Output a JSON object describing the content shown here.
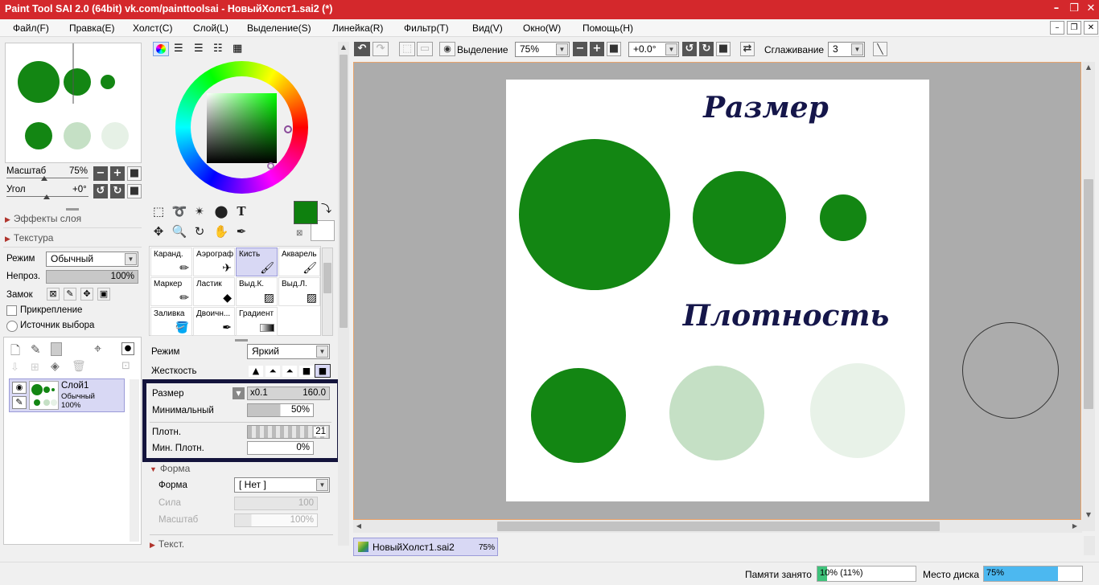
{
  "window": {
    "title": "Paint Tool SAI 2.0 (64bit) vk.com/painttoolsai - НовыйХолст1.sai2 (*)"
  },
  "menu": [
    "Файл(F)",
    "Правка(E)",
    "Холст(C)",
    "Слой(L)",
    "Выделение(S)",
    "Линейка(R)",
    "Фильтр(T)",
    "Вид(V)",
    "Окно(W)",
    "Помощь(H)"
  ],
  "nav": {
    "scale_label": "Масштаб",
    "scale_value": "75%",
    "angle_label": "Угол",
    "angle_value": "+0°"
  },
  "sections": {
    "layer_effects": "Эффекты слоя",
    "texture": "Текстура",
    "shape": "Форма",
    "text": "Текст."
  },
  "layer": {
    "mode_label": "Режим",
    "mode_value": "Обычный",
    "opacity_label": "Непроз.",
    "opacity_value": "100%",
    "lock_label": "Замок",
    "clip_label": "Прикрепление",
    "source_label": "Источник выбора",
    "name": "Слой1",
    "mode": "Обычный",
    "opacity": "100%"
  },
  "brushes": [
    [
      "Каранд.",
      "Аэрограф",
      "Кисть",
      "Акварель"
    ],
    [
      "Маркер",
      "Ластик",
      "Выд.К.",
      "Выд.Л."
    ],
    [
      "Заливка",
      "Двоичн...",
      "Градиент",
      ""
    ]
  ],
  "brush_settings": {
    "mode_label": "Режим",
    "mode_value": "Яркий",
    "hardness_label": "Жесткость",
    "size_label": "Размер",
    "size_mult": "x0.1",
    "size_value": "160.0",
    "min_label": "Минимальный",
    "min_value": "50%",
    "density_label": "Плотн.",
    "density_value": "21",
    "min_density_label": "Мин. Плотн.",
    "min_density_value": "0%",
    "shape_label": "Форма",
    "shape_value": "[ Нет ]",
    "strength_label": "Сила",
    "strength_value": "100",
    "scale_label": "Масштаб",
    "scale_value": "100%"
  },
  "toolbar": {
    "selection_label": "Выделение",
    "zoom_value": "75%",
    "angle_value": "+0.0°",
    "smoothing_label": "Сглаживание",
    "smoothing_value": "3"
  },
  "canvas": {
    "heading1": "Размер",
    "heading2": "Плотность",
    "brush_color": "#138613"
  },
  "tabs": [
    {
      "name": "НовыйХолст1.sai2",
      "zoom": "75%"
    }
  ],
  "status": {
    "memory_label": "Памяти занято",
    "memory_value": "10% (11%)",
    "memory_fraction": 0.1,
    "disk_label": "Место диска",
    "disk_value": "75%",
    "disk_fraction": 0.75
  },
  "colors": {
    "title_bar": "#d4282c",
    "primary_color": "#0e800e",
    "highlight_box": "#14143c"
  }
}
